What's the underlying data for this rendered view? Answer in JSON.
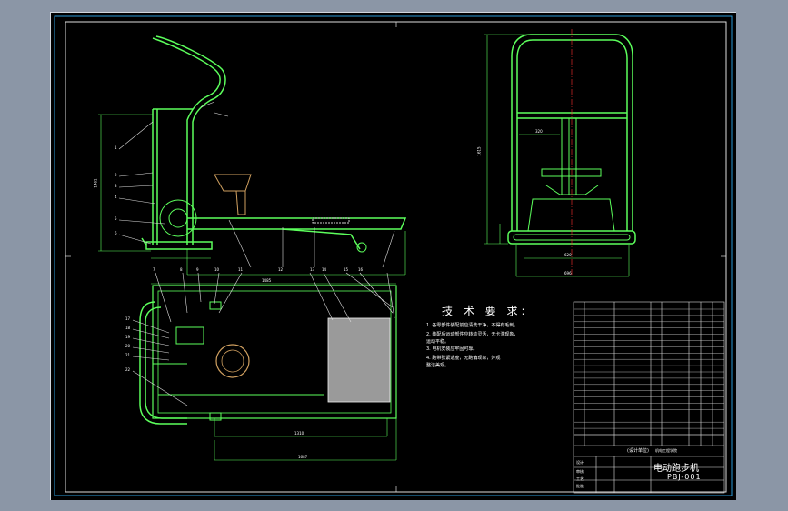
{
  "drawing": {
    "title_block": {
      "name": "电动跑步机",
      "code": "PBJ-001",
      "unit_note": "(设计单位)",
      "school": "机电工程学院",
      "labels": [
        "设计",
        "审核",
        "工艺",
        "批准"
      ]
    },
    "tech_requirements": {
      "title": "技 术 要 求:",
      "lines": [
        "1. 各零部件装配前应清洗干净，不得有毛刺。",
        "2. 装配后运动部件应转动灵活，无卡滞现象，",
        "   运动平稳。",
        "3. 电机安装应牢固可靠。",
        "4. 跑带张紧适度，无跑偏现象，外观",
        "   整洁美观。"
      ]
    },
    "dimensions": {
      "side_height": "1461",
      "front_height": "1615",
      "front_width_inner": "620",
      "front_width_outer": "696",
      "plan_length": "1485",
      "plan_inner": "1310",
      "plan_total": "1687",
      "front_mid": "320"
    },
    "part_numbers": [
      "1",
      "2",
      "3",
      "4",
      "5",
      "6",
      "7",
      "8",
      "9",
      "10",
      "11",
      "12",
      "13",
      "14",
      "15",
      "16",
      "17",
      "18",
      "19",
      "20",
      "21",
      "22"
    ]
  }
}
